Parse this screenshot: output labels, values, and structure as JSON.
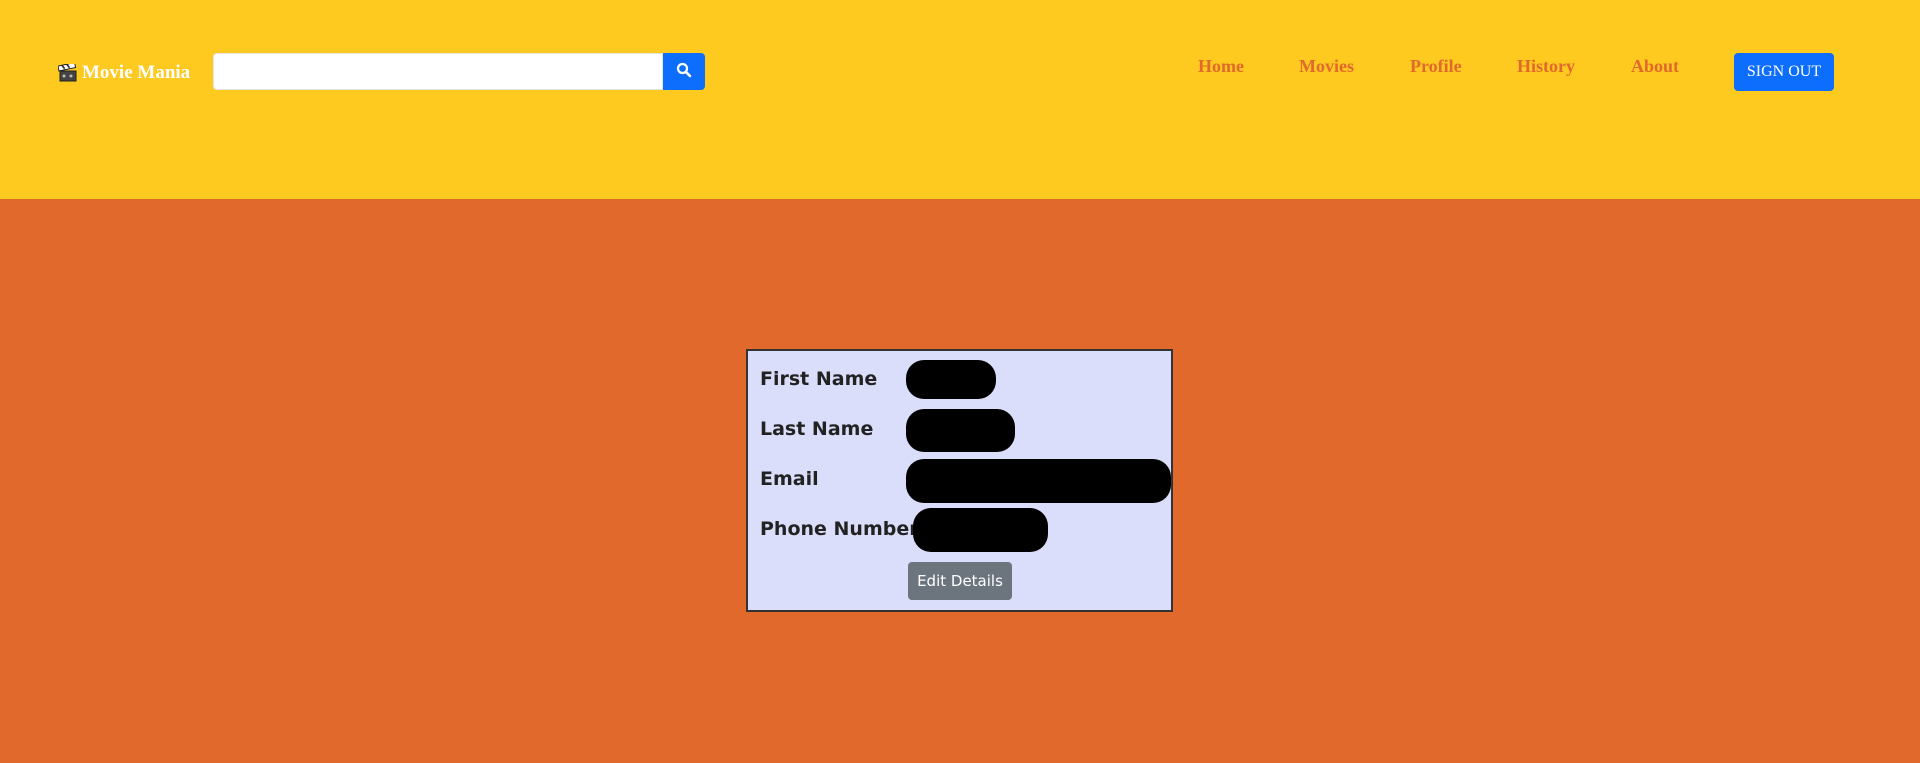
{
  "header": {
    "brand_name": "Movie Mania",
    "brand_icon": "clapperboard-icon",
    "search": {
      "value": "",
      "placeholder": "",
      "button_icon": "search-icon"
    },
    "nav": [
      {
        "label": "Home"
      },
      {
        "label": "Movies"
      },
      {
        "label": "Profile"
      },
      {
        "label": "History"
      },
      {
        "label": "About"
      }
    ],
    "signout_label": "SIGN OUT"
  },
  "profile": {
    "fields": [
      {
        "label": "First Name",
        "value": ""
      },
      {
        "label": "Last Name",
        "value": ""
      },
      {
        "label": "Email",
        "value": ""
      },
      {
        "label": "Phone Number",
        "value": ""
      }
    ],
    "edit_label": "Edit Details"
  },
  "colors": {
    "header_bg": "#ffca1f",
    "page_bg": "#e2692c",
    "nav_link": "#e2692c",
    "primary_button": "#0d6efd",
    "card_bg": "#dadefa",
    "secondary_button": "#6c757d"
  }
}
